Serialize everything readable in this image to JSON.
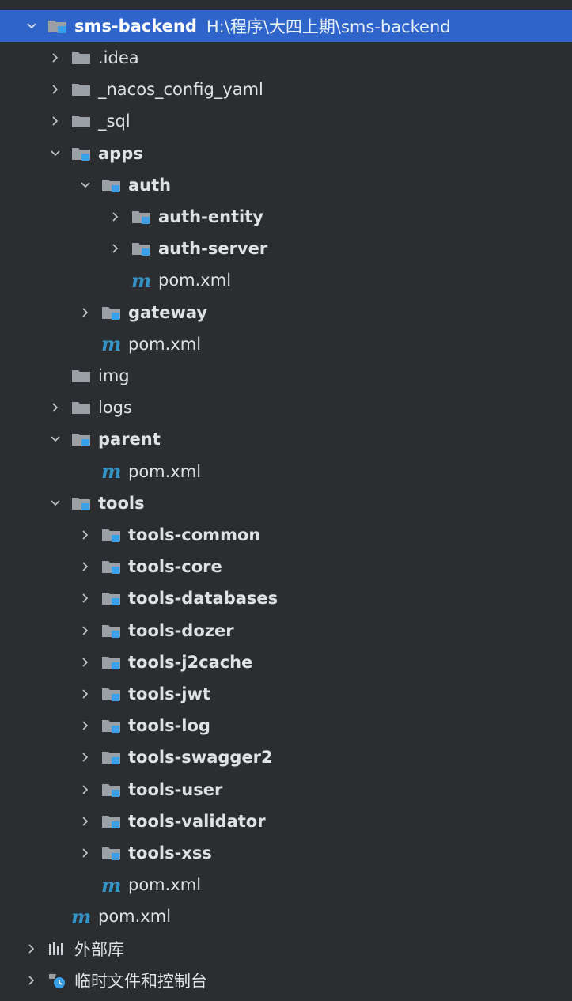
{
  "colors": {
    "background": "#2b2d30",
    "selection": "#2f65ca",
    "text": "#dfe1e5",
    "folder": "#9aa0a6",
    "module_badge": "#3aa0e8",
    "maven": "#3592c4"
  },
  "tree": {
    "root": {
      "name": "sms-backend",
      "path": "H:\\程序\\大四上期\\sms-backend",
      "expanded": true,
      "icon": "module-folder-icon"
    },
    "items": [
      {
        "name": ".idea",
        "level": 1,
        "type": "folder",
        "chevron": "right"
      },
      {
        "name": "_nacos_config_yaml",
        "level": 1,
        "type": "folder",
        "chevron": "right"
      },
      {
        "name": "_sql",
        "level": 1,
        "type": "folder",
        "chevron": "right"
      },
      {
        "name": "apps",
        "level": 1,
        "type": "module",
        "chevron": "down"
      },
      {
        "name": "auth",
        "level": 2,
        "type": "module",
        "chevron": "down"
      },
      {
        "name": "auth-entity",
        "level": 3,
        "type": "module",
        "chevron": "right"
      },
      {
        "name": "auth-server",
        "level": 3,
        "type": "module",
        "chevron": "right"
      },
      {
        "name": "pom.xml",
        "level": 3,
        "type": "maven",
        "chevron": "none"
      },
      {
        "name": "gateway",
        "level": 2,
        "type": "module",
        "chevron": "right"
      },
      {
        "name": "pom.xml",
        "level": 2,
        "type": "maven",
        "chevron": "none"
      },
      {
        "name": "img",
        "level": 1,
        "type": "folder",
        "chevron": "none"
      },
      {
        "name": "logs",
        "level": 1,
        "type": "folder",
        "chevron": "right"
      },
      {
        "name": "parent",
        "level": 1,
        "type": "module",
        "chevron": "down"
      },
      {
        "name": "pom.xml",
        "level": 2,
        "type": "maven",
        "chevron": "none"
      },
      {
        "name": "tools",
        "level": 1,
        "type": "module",
        "chevron": "down"
      },
      {
        "name": "tools-common",
        "level": 2,
        "type": "module",
        "chevron": "right"
      },
      {
        "name": "tools-core",
        "level": 2,
        "type": "module",
        "chevron": "right"
      },
      {
        "name": "tools-databases",
        "level": 2,
        "type": "module",
        "chevron": "right"
      },
      {
        "name": "tools-dozer",
        "level": 2,
        "type": "module",
        "chevron": "right"
      },
      {
        "name": "tools-j2cache",
        "level": 2,
        "type": "module",
        "chevron": "right"
      },
      {
        "name": "tools-jwt",
        "level": 2,
        "type": "module",
        "chevron": "right"
      },
      {
        "name": "tools-log",
        "level": 2,
        "type": "module",
        "chevron": "right"
      },
      {
        "name": "tools-swagger2",
        "level": 2,
        "type": "module",
        "chevron": "right"
      },
      {
        "name": "tools-user",
        "level": 2,
        "type": "module",
        "chevron": "right"
      },
      {
        "name": "tools-validator",
        "level": 2,
        "type": "module",
        "chevron": "right"
      },
      {
        "name": "tools-xss",
        "level": 2,
        "type": "module",
        "chevron": "right"
      },
      {
        "name": "pom.xml",
        "level": 2,
        "type": "maven",
        "chevron": "none"
      },
      {
        "name": "pom.xml",
        "level": 1,
        "type": "maven",
        "chevron": "none"
      },
      {
        "name": "外部库",
        "level": 0,
        "type": "libraries",
        "chevron": "right"
      },
      {
        "name": "临时文件和控制台",
        "level": 0,
        "type": "scratches",
        "chevron": "right"
      }
    ]
  }
}
